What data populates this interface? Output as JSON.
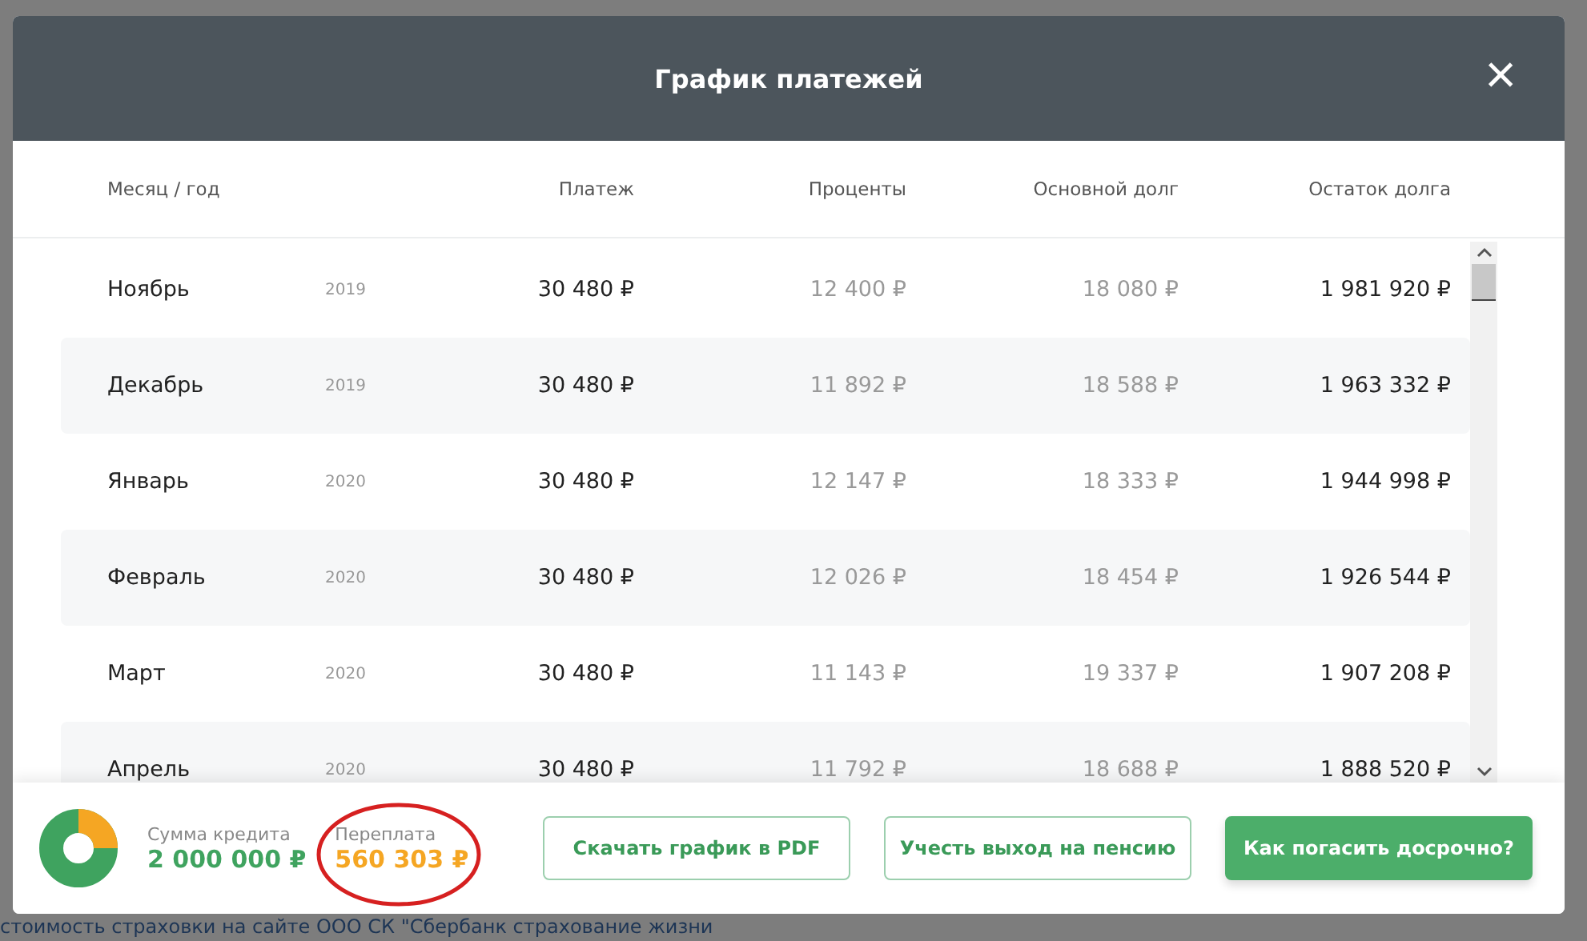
{
  "dialog": {
    "title": "График платежей",
    "close": "×"
  },
  "table": {
    "columns": [
      "Месяц / год",
      "Платеж",
      "Проценты",
      "Основной долг",
      "Остаток долга"
    ],
    "rows": [
      {
        "month": "Ноябрь",
        "year": "2019",
        "payment": "30 480 ₽",
        "interest": "12 400 ₽",
        "principal": "18 080 ₽",
        "balance": "1 981 920 ₽"
      },
      {
        "month": "Декабрь",
        "year": "2019",
        "payment": "30 480 ₽",
        "interest": "11 892 ₽",
        "principal": "18 588 ₽",
        "balance": "1 963 332 ₽"
      },
      {
        "month": "Январь",
        "year": "2020",
        "payment": "30 480 ₽",
        "interest": "12 147 ₽",
        "principal": "18 333 ₽",
        "balance": "1 944 998 ₽"
      },
      {
        "month": "Февраль",
        "year": "2020",
        "payment": "30 480 ₽",
        "interest": "12 026 ₽",
        "principal": "18 454 ₽",
        "balance": "1 926 544 ₽"
      },
      {
        "month": "Март",
        "year": "2020",
        "payment": "30 480 ₽",
        "interest": "11 143 ₽",
        "principal": "19 337 ₽",
        "balance": "1 907 208 ₽"
      },
      {
        "month": "Апрель",
        "year": "2020",
        "payment": "30 480 ₽",
        "interest": "11 792 ₽",
        "principal": "18 688 ₽",
        "balance": "1 888 520 ₽"
      }
    ]
  },
  "summary": [
    {
      "label": "Сумма кредита",
      "value": "2 000 000 ₽",
      "color": "#3fa35f",
      "circled": false
    },
    {
      "label": "Переплата",
      "value": "560 303 ₽",
      "color": "#f5a623",
      "circled": true
    }
  ],
  "buttons": [
    {
      "label": "Скачать график в PDF",
      "kind": "outline"
    },
    {
      "label": "Учесть выход на пенсию",
      "kind": "outline"
    },
    {
      "label": "Как погасить досрочно?",
      "kind": "primary"
    }
  ],
  "background_text": "стоимость страховки на сайте ООО СК \"Сбербанк страхование жизни"
}
